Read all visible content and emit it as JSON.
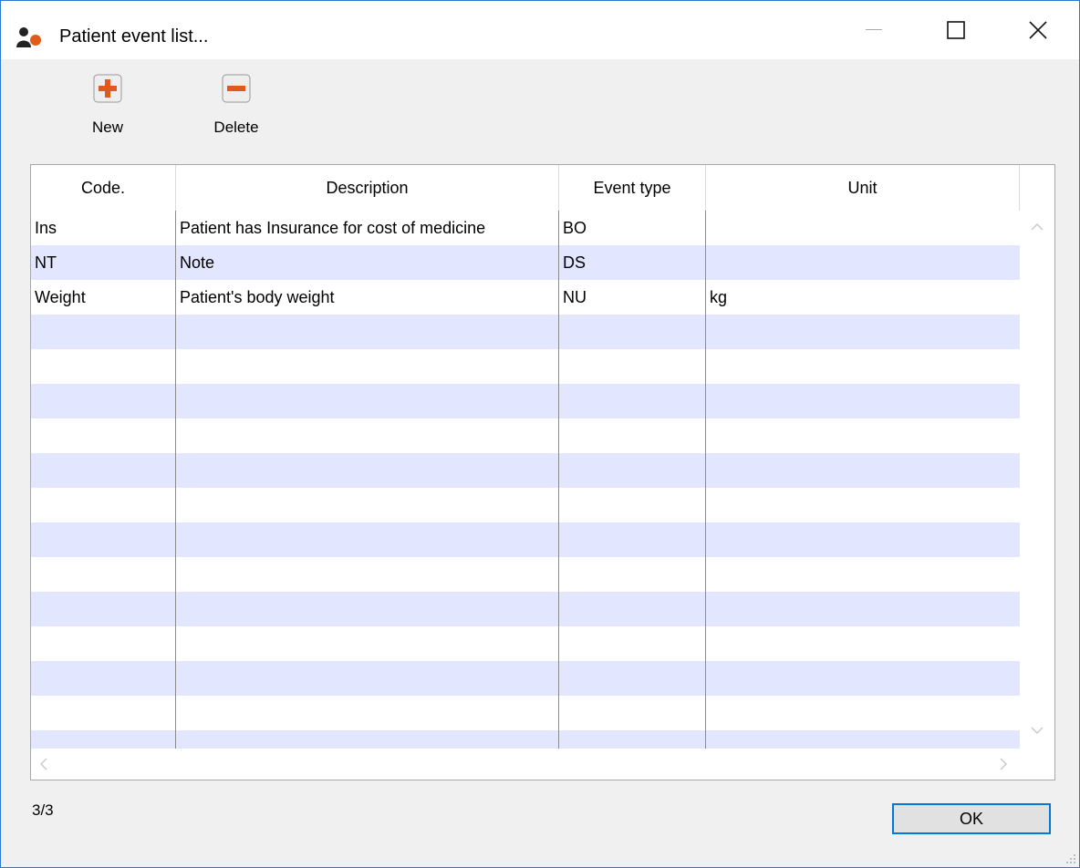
{
  "window": {
    "title": "Patient event list..."
  },
  "toolbar": {
    "new_label": "New",
    "delete_label": "Delete"
  },
  "table": {
    "columns": [
      "Code.",
      "Description",
      "Event type",
      "Unit"
    ],
    "rows": [
      [
        "Ins",
        "Patient has Insurance for cost of medicine",
        "BO",
        ""
      ],
      [
        "NT",
        "Note",
        "DS",
        ""
      ],
      [
        "Weight",
        "Patient's body weight",
        "NU",
        "kg"
      ]
    ]
  },
  "footer": {
    "count": "3/3",
    "ok_label": "OK"
  },
  "colors": {
    "accent": "#0078d7",
    "stripe": "#e3e6ff",
    "icon_orange": "#e05a1c"
  }
}
